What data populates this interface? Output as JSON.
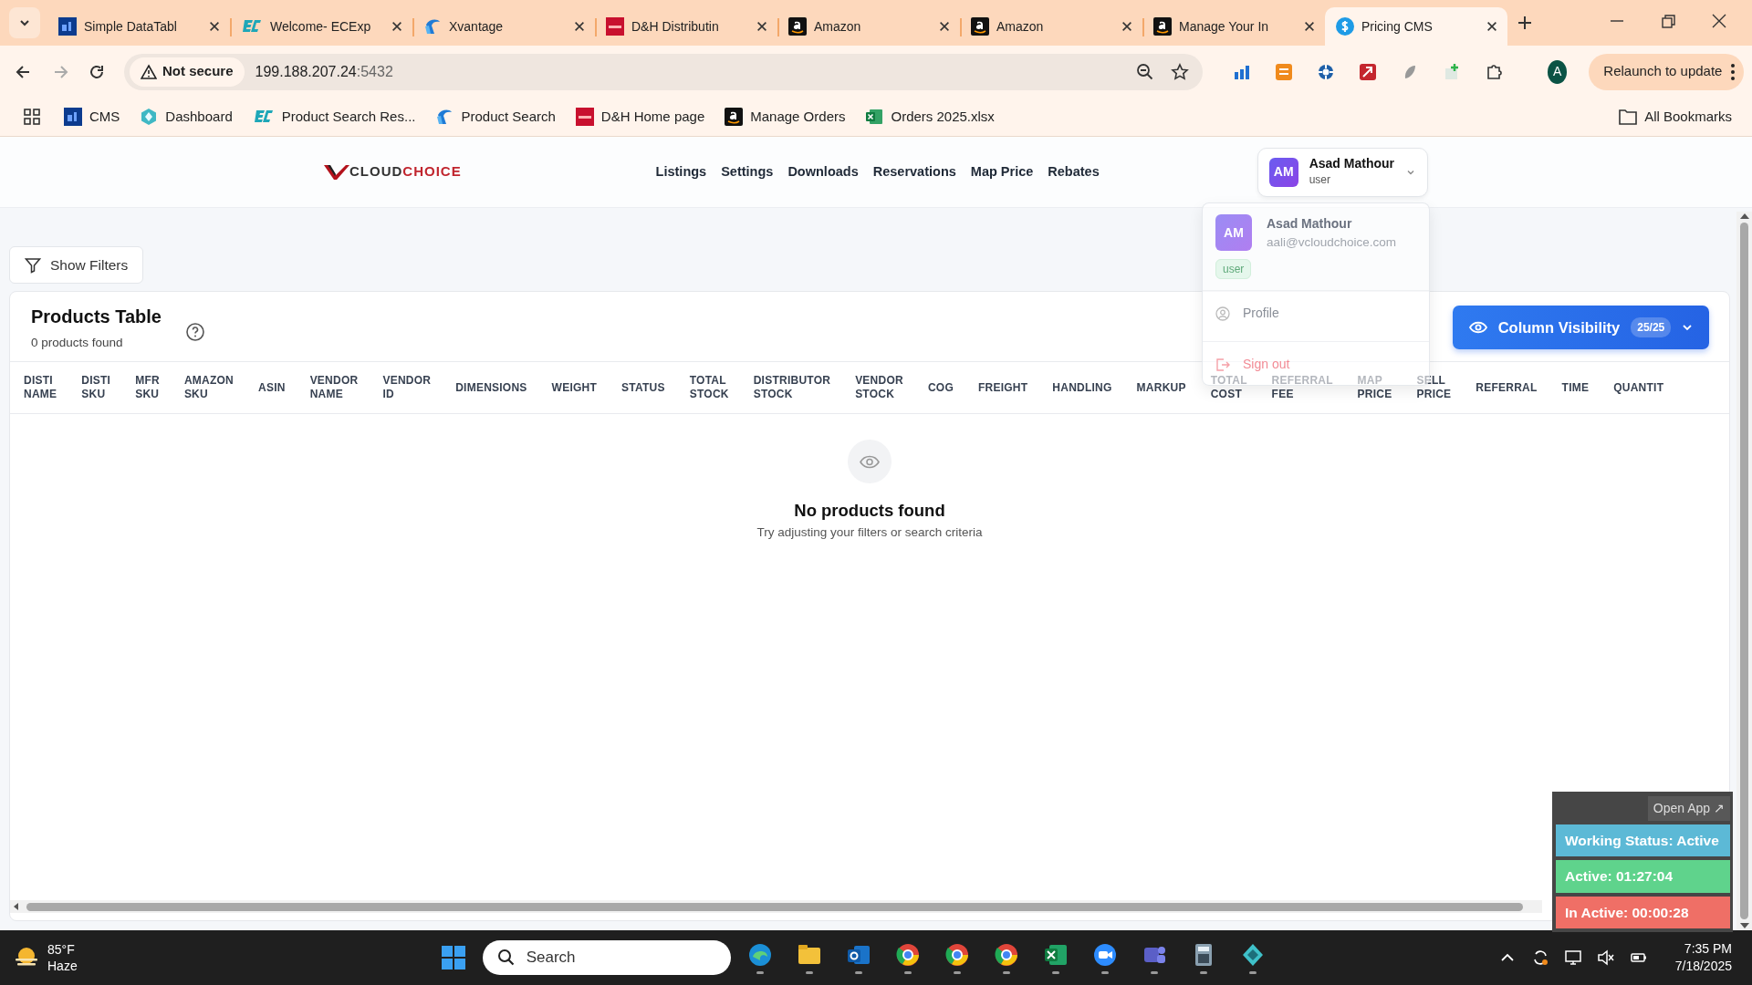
{
  "browser": {
    "tabs": [
      {
        "title": "Simple DataTabl",
        "kind": "df",
        "selected": false
      },
      {
        "title": "Welcome- ECExp",
        "kind": "ec",
        "selected": false
      },
      {
        "title": "Xvantage",
        "kind": "xv",
        "selected": false
      },
      {
        "title": "D&H Distributin",
        "kind": "dh",
        "selected": false
      },
      {
        "title": "Amazon",
        "kind": "amazon",
        "selected": false
      },
      {
        "title": "Amazon",
        "kind": "amazon",
        "selected": false
      },
      {
        "title": "Manage Your In",
        "kind": "amazon",
        "selected": false
      },
      {
        "title": "Pricing CMS",
        "kind": "dollar",
        "selected": true
      }
    ],
    "address": {
      "security": "Not secure",
      "host": "199.188.207.24",
      "port": ":5432"
    },
    "profile_initial": "A",
    "relaunch": "Relaunch to update",
    "bookmarks": [
      {
        "title": "CMS",
        "kind": "df"
      },
      {
        "title": "Dashboard",
        "kind": "hex"
      },
      {
        "title": "Product Search Res...",
        "kind": "ec"
      },
      {
        "title": "Product Search",
        "kind": "xv"
      },
      {
        "title": "D&H Home page",
        "kind": "dh"
      },
      {
        "title": "Manage Orders",
        "kind": "amazon"
      },
      {
        "title": "Orders 2025.xlsx",
        "kind": "excel"
      }
    ],
    "all_bookmarks": "All Bookmarks"
  },
  "app": {
    "logo": {
      "first": "CLOUD",
      "second": "CHOICE"
    },
    "nav": [
      "Listings",
      "Settings",
      "Downloads",
      "Reservations",
      "Map Price",
      "Rebates"
    ],
    "user": {
      "initials": "AM",
      "name": "Asad Mathour",
      "role": "user"
    },
    "user_menu": {
      "initials": "AM",
      "name": "Asad Mathour",
      "email": "aali@vcloudchoice.com",
      "badge": "user",
      "items": [
        {
          "label": "Profile",
          "kind": "profile"
        },
        {
          "label": "Sign out",
          "kind": "signout"
        }
      ]
    },
    "show_filters": "Show Filters",
    "table": {
      "title": "Products Table",
      "subtitle": "0 products found",
      "column_visibility": {
        "label": "Column Visibility",
        "count": "25/25"
      },
      "columns": [
        "DISTI NAME",
        "DISTI SKU",
        "MFR SKU",
        "AMAZON SKU",
        "ASIN",
        "VENDOR NAME",
        "VENDOR ID",
        "DIMENSIONS",
        "WEIGHT",
        "STATUS",
        "TOTAL STOCK",
        "DISTRIBUTOR STOCK",
        "VENDOR STOCK",
        "COG",
        "FREIGHT",
        "HANDLING",
        "MARKUP",
        "TOTAL COST",
        "REFERRAL FEE",
        "MAP PRICE",
        "SELL PRICE",
        "REFERRAL",
        "TIME",
        "QUANTIT"
      ],
      "empty": {
        "title": "No products found",
        "hint": "Try adjusting your filters or search criteria"
      }
    }
  },
  "tracker": {
    "open_app": "Open App ↗",
    "rows": [
      {
        "text": "Working Status: Active",
        "color": "#5cb9d6"
      },
      {
        "text": "Active: 01:27:04",
        "color": "#5fd38c"
      },
      {
        "text": "In Active: 00:00:28",
        "color": "#ef6f66"
      }
    ]
  },
  "taskbar": {
    "temperature": "85°F",
    "weather": "Haze",
    "search": "Search",
    "time": "7:35 PM",
    "date": "7/18/2025"
  }
}
